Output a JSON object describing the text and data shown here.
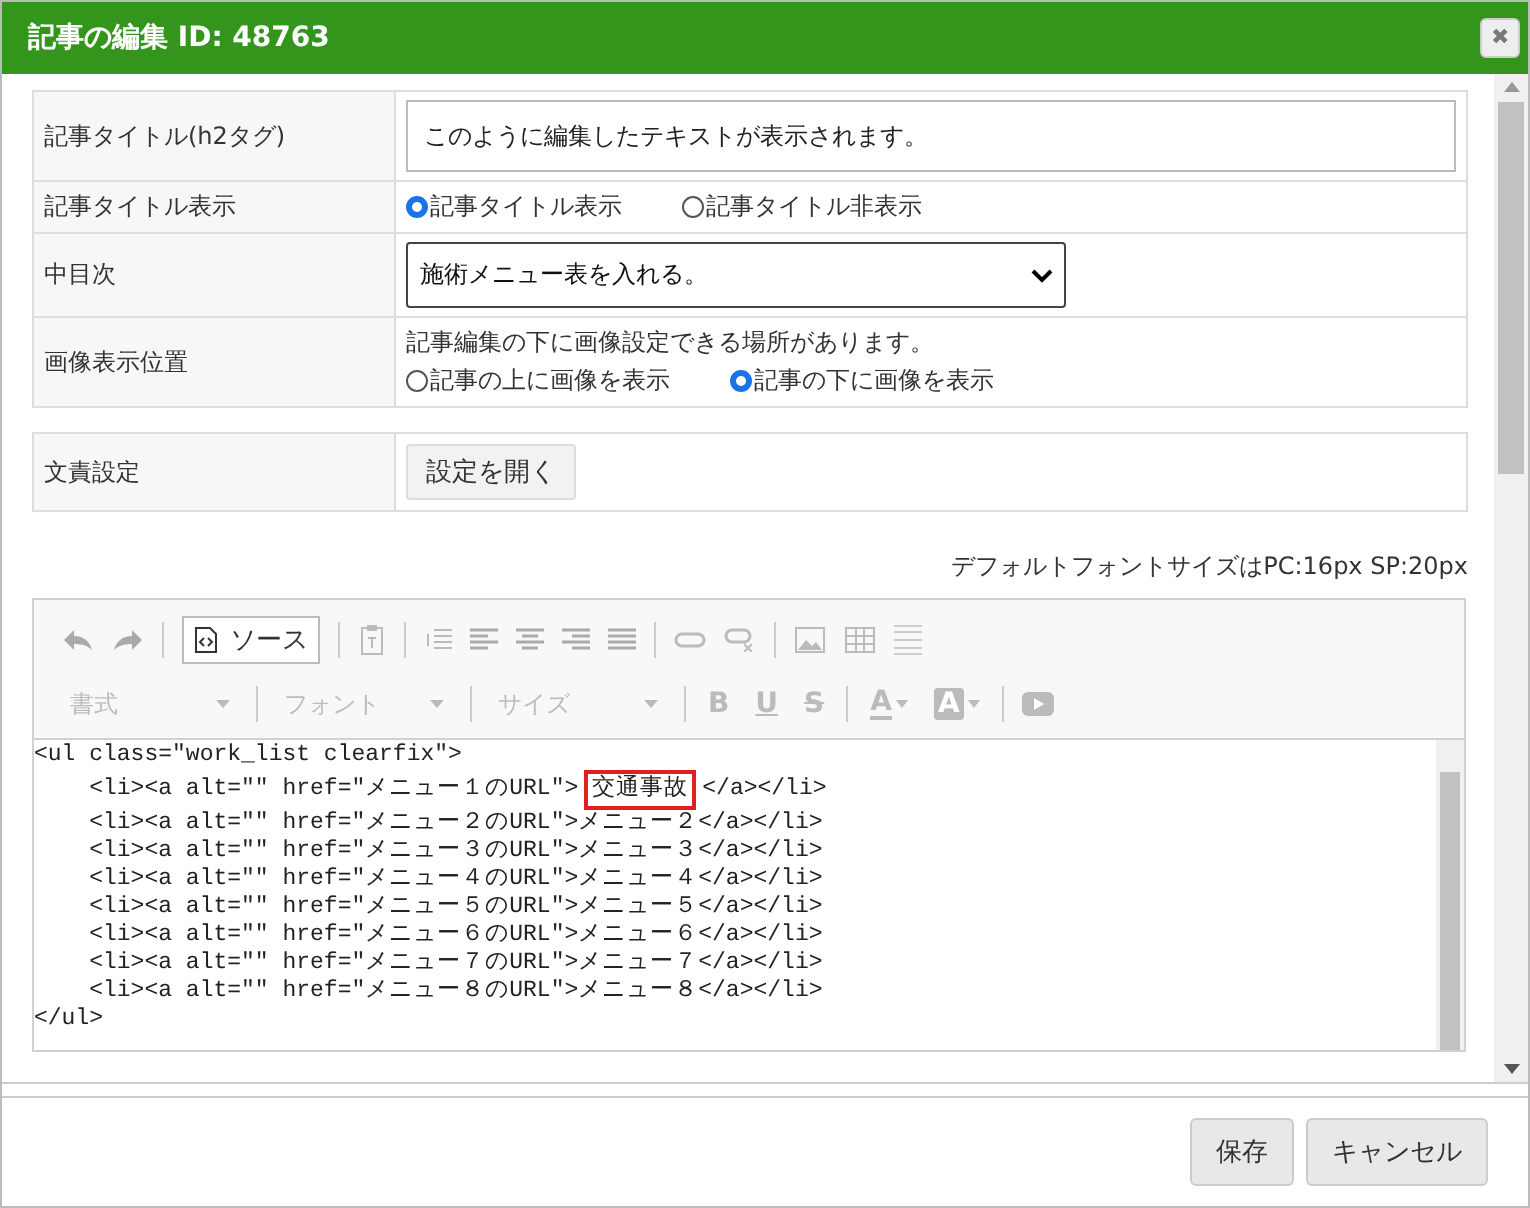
{
  "dialog": {
    "title": "記事の編集 ID: 48763",
    "close": "✖"
  },
  "form_rows": [
    {
      "label": "記事タイトル(h2タグ)",
      "kind": "text",
      "value": "このように編集したテキストが表示されます。"
    },
    {
      "label": "記事タイトル表示",
      "kind": "radio",
      "options": [
        {
          "label": "記事タイトル表示",
          "selected": true
        },
        {
          "label": "記事タイトル非表示",
          "selected": false
        }
      ]
    },
    {
      "label": "中目次",
      "kind": "select",
      "value": "施術メニュー表を入れる。"
    },
    {
      "label": "画像表示位置",
      "kind": "radio",
      "note": "記事編集の下に画像設定できる場所があります。",
      "options": [
        {
          "label": "記事の上に画像を表示",
          "selected": false
        },
        {
          "label": "記事の下に画像を表示",
          "selected": true
        }
      ]
    }
  ],
  "settings_row": {
    "label": "文責設定",
    "button": "設定を開く"
  },
  "font_note": "デフォルトフォントサイズはPC:16px SP:20px",
  "editor": {
    "toolbar_disabled": true,
    "source_button": "ソース",
    "dropdowns": [
      "書式",
      "フォント",
      "サイズ"
    ],
    "style_buttons": [
      "B",
      "U",
      "S"
    ],
    "color_buttons": [
      "A",
      "A"
    ],
    "code_lines": [
      {
        "text": "<ul class=\"work_list clearfix\">"
      },
      {
        "text": "    <li><a alt=\"\" href=\"メニュー１のURL\">",
        "highlight": "交通事故",
        "after": "</a></li>"
      },
      {
        "text": "    <li><a alt=\"\" href=\"メニュー２のURL\">メニュー２</a></li>"
      },
      {
        "text": "    <li><a alt=\"\" href=\"メニュー３のURL\">メニュー３</a></li>"
      },
      {
        "text": "    <li><a alt=\"\" href=\"メニュー４のURL\">メニュー４</a></li>"
      },
      {
        "text": "    <li><a alt=\"\" href=\"メニュー５のURL\">メニュー５</a></li>"
      },
      {
        "text": "    <li><a alt=\"\" href=\"メニュー６のURL\">メニュー６</a></li>"
      },
      {
        "text": "    <li><a alt=\"\" href=\"メニュー７のURL\">メニュー７</a></li>"
      },
      {
        "text": "    <li><a alt=\"\" href=\"メニュー８のURL\">メニュー８</a></li>"
      },
      {
        "text": "</ul>"
      }
    ]
  },
  "buttons": [
    {
      "label": "保存"
    },
    {
      "label": "キャンセル"
    }
  ]
}
